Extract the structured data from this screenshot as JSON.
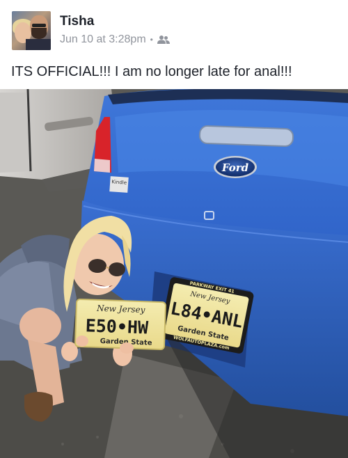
{
  "post": {
    "author": "Tisha",
    "timestamp": "Jun 10 at 3:28pm",
    "separator": "•",
    "audience_icon": "friends-icon",
    "text": "ITS OFFICIAL!!! I am no longer late for anal!!!"
  },
  "photo": {
    "car_badge": "Ford",
    "dealer_badge": "Kindle",
    "old_plate": {
      "state": "New Jersey",
      "number": "L84•ANL",
      "motto": "Garden State",
      "frame_top": "PARKWAY EXIT 41",
      "frame_bottom": "WOLFAUTOPLAZA.com"
    },
    "new_plate": {
      "state": "New Jersey",
      "number": "E50•HW",
      "motto": "Garden State"
    }
  }
}
